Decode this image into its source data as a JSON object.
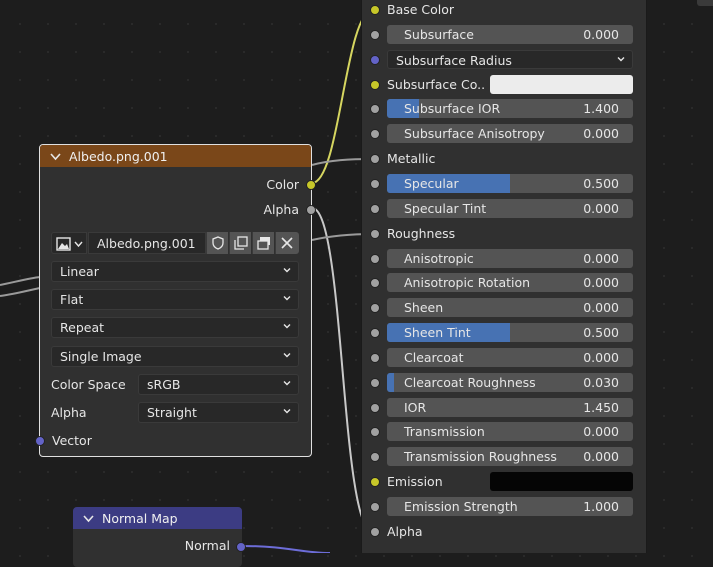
{
  "colors": {
    "canvas": "#1d1d1d",
    "node_bg": "#303030",
    "field_bg": "#545454",
    "accent_fill": "#4772b3",
    "texture_header": "#7a4719",
    "vector_header": "#3c3c83",
    "socket_color": "#c7c729",
    "socket_float": "#a1a1a1",
    "socket_vector": "#6363c7",
    "subsurface_color_swatch": "#ececec",
    "emission_swatch": "#050505"
  },
  "bsdf": {
    "rows": [
      {
        "type": "socket",
        "label": "Base Color",
        "socket": "yellow"
      },
      {
        "type": "field",
        "label": "Subsurface",
        "value": "0.000",
        "fill": 0
      },
      {
        "type": "dropdown",
        "label": "Subsurface Radius",
        "socket": "violet"
      },
      {
        "type": "color",
        "label": "Subsurface Co...",
        "swatch": "#ececec",
        "socket": "yellow"
      },
      {
        "type": "field",
        "label": "Subsurface IOR",
        "value": "1.400",
        "fill": 0.13
      },
      {
        "type": "field",
        "label": "Subsurface Anisotropy",
        "value": "0.000",
        "fill": 0
      },
      {
        "type": "socket",
        "label": "Metallic",
        "socket": "grey"
      },
      {
        "type": "field",
        "label": "Specular",
        "value": "0.500",
        "fill": 0.5
      },
      {
        "type": "field",
        "label": "Specular Tint",
        "value": "0.000",
        "fill": 0
      },
      {
        "type": "socket",
        "label": "Roughness",
        "socket": "grey"
      },
      {
        "type": "field",
        "label": "Anisotropic",
        "value": "0.000",
        "fill": 0
      },
      {
        "type": "field",
        "label": "Anisotropic Rotation",
        "value": "0.000",
        "fill": 0
      },
      {
        "type": "field",
        "label": "Sheen",
        "value": "0.000",
        "fill": 0
      },
      {
        "type": "field",
        "label": "Sheen Tint",
        "value": "0.500",
        "fill": 0.5
      },
      {
        "type": "field",
        "label": "Clearcoat",
        "value": "0.000",
        "fill": 0
      },
      {
        "type": "field",
        "label": "Clearcoat Roughness",
        "value": "0.030",
        "fill": 0.03
      },
      {
        "type": "field",
        "label": "IOR",
        "value": "1.450",
        "fill": 0
      },
      {
        "type": "field",
        "label": "Transmission",
        "value": "0.000",
        "fill": 0
      },
      {
        "type": "field",
        "label": "Transmission Roughness",
        "value": "0.000",
        "fill": 0
      },
      {
        "type": "color",
        "label": "Emission",
        "swatch": "#050505",
        "socket": "yellow"
      },
      {
        "type": "field",
        "label": "Emission Strength",
        "value": "1.000",
        "fill": 0
      },
      {
        "type": "socket",
        "label": "Alpha",
        "socket": "grey"
      }
    ]
  },
  "image_node": {
    "title": "Albedo.png.001",
    "outputs": {
      "color": "Color",
      "alpha": "Alpha"
    },
    "image_name": "Albedo.png.001",
    "interpolation": "Linear",
    "projection": "Flat",
    "extension": "Repeat",
    "source": "Single Image",
    "color_space_label": "Color Space",
    "color_space_value": "sRGB",
    "alpha_label": "Alpha",
    "alpha_value": "Straight",
    "input_vector": "Vector"
  },
  "normal_map_node": {
    "title": "Normal Map",
    "output": "Normal"
  }
}
